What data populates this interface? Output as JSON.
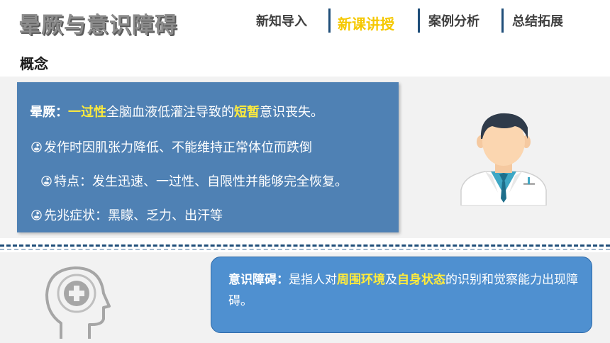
{
  "slide": {
    "title": "晕厥与意识障碍"
  },
  "nav": {
    "tabs": [
      {
        "label": "新知导入",
        "active": false
      },
      {
        "label": "新课讲授",
        "active": true
      },
      {
        "label": "案例分析",
        "active": false
      },
      {
        "label": "总结拓展",
        "active": false
      }
    ]
  },
  "section": {
    "label": "概念"
  },
  "syncope": {
    "term": "晕厥：",
    "kw1": "一过性",
    "mid": "全脑血液低灌注导致的",
    "kw2": "短暂",
    "end": "意识丧失。",
    "bullets": [
      "发作时因肌张力降低、不能维持正常体位而跌倒",
      "特点：发生迅速、一过性、自限性并能够完全恢复。",
      "先兆症状：黑矇、乏力、出汗等"
    ]
  },
  "consciousness": {
    "term": "意识障碍：",
    "pre": "是指人对",
    "kw1": "周围环境",
    "mid": "及",
    "kw2": "自身状态",
    "end": "的识别和觉察能力出现障碍。"
  },
  "colors": {
    "accent": "#f5c800",
    "card": "#4f81b4",
    "card2": "#4f90d0",
    "navy": "#1f4e79",
    "keyword": "#ffeb3b"
  },
  "icons": {
    "bullet": "radiation-bullet-icon",
    "doctor": "doctor-avatar-icon",
    "head": "head-plus-icon"
  }
}
